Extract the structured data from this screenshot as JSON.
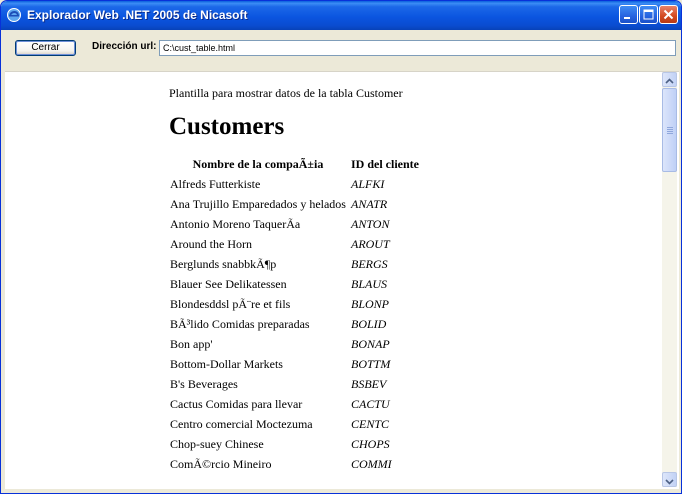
{
  "window": {
    "title": "Explorador Web .NET 2005 de Nicasoft"
  },
  "toolbar": {
    "close_label": "Cerrar",
    "address_label": "Dirección url:",
    "address_value": "C:\\cust_table.html"
  },
  "page": {
    "intro": "Plantilla para mostrar datos de la tabla Customer",
    "heading": "Customers",
    "columns": [
      "Nombre de la compaÃ±ia",
      "ID del cliente"
    ],
    "rows": [
      {
        "name": "Alfreds Futterkiste",
        "id": "ALFKI"
      },
      {
        "name": "Ana Trujillo Emparedados y helados",
        "id": "ANATR"
      },
      {
        "name": "Antonio Moreno TaquerÃa",
        "id": "ANTON"
      },
      {
        "name": "Around the Horn",
        "id": "AROUT"
      },
      {
        "name": "Berglunds snabbkÃ¶p",
        "id": "BERGS"
      },
      {
        "name": "Blauer See Delikatessen",
        "id": "BLAUS"
      },
      {
        "name": "Blondesddsl pÃ¨re et fils",
        "id": "BLONP"
      },
      {
        "name": "BÃ³lido Comidas preparadas",
        "id": "BOLID"
      },
      {
        "name": "Bon app'",
        "id": "BONAP"
      },
      {
        "name": "Bottom-Dollar Markets",
        "id": "BOTTM"
      },
      {
        "name": "B's Beverages",
        "id": "BSBEV"
      },
      {
        "name": "Cactus Comidas para llevar",
        "id": "CACTU"
      },
      {
        "name": "Centro comercial Moctezuma",
        "id": "CENTC"
      },
      {
        "name": "Chop-suey Chinese",
        "id": "CHOPS"
      },
      {
        "name": "ComÃ©rcio Mineiro",
        "id": "COMMI"
      }
    ]
  },
  "icons": {
    "app": "ie-globe-icon",
    "minimize": "minimize-icon",
    "maximize": "maximize-icon",
    "close": "close-icon",
    "scroll_up": "arrow-up-icon",
    "scroll_down": "arrow-down-icon"
  },
  "colors": {
    "titlebar": "#0B55E0",
    "close_button": "#D2491F",
    "chrome": "#ECE9D8"
  }
}
